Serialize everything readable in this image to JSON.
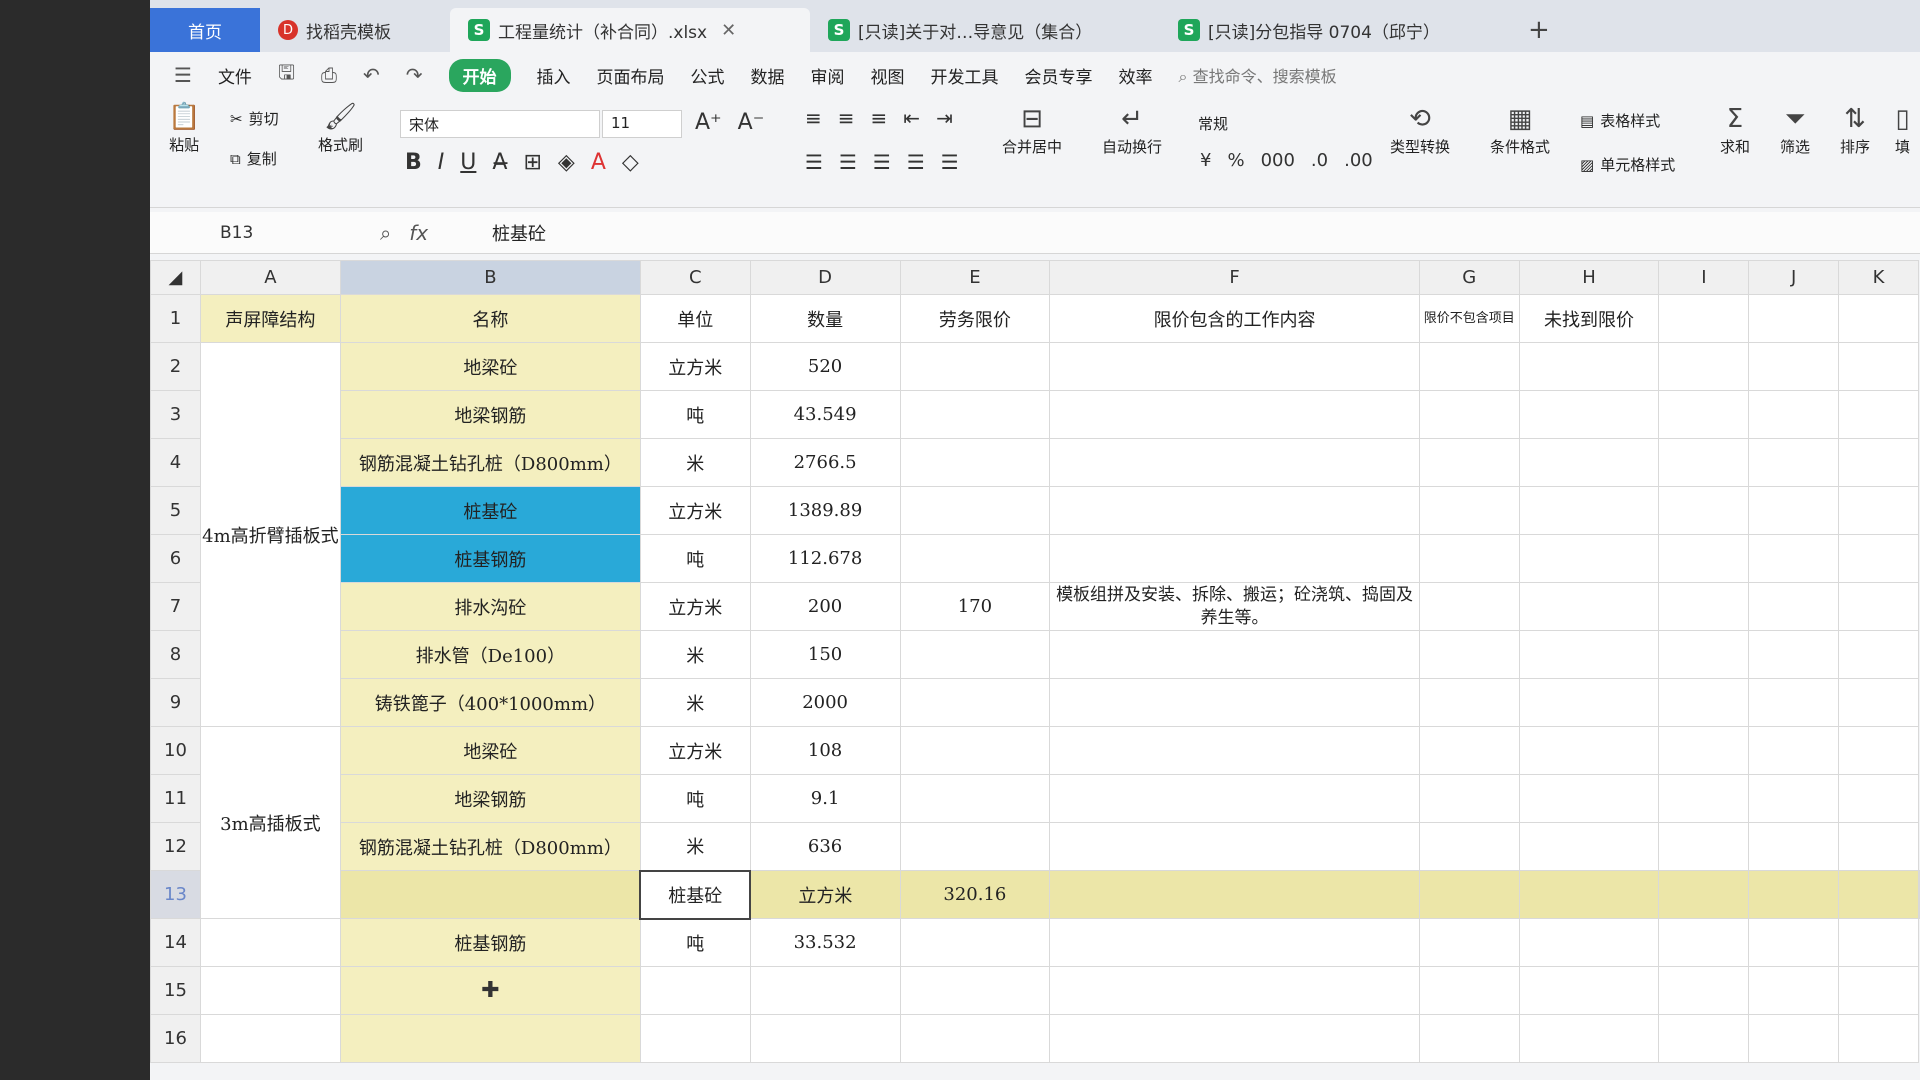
{
  "tabs": [
    {
      "label": "首页"
    },
    {
      "label": "找稻壳模板"
    },
    {
      "label": "工程量统计（补合同）.xlsx"
    },
    {
      "label": "[只读]关于对…导意见（集合）"
    },
    {
      "label": "[只读]分包指导 0704（邱宁）"
    }
  ],
  "menu": {
    "file": "文件",
    "items": [
      "开始",
      "插入",
      "页面布局",
      "公式",
      "数据",
      "审阅",
      "视图",
      "开发工具",
      "会员专享",
      "效率"
    ],
    "search": "查找命令、搜索模板"
  },
  "ribbon": {
    "paste": "粘贴",
    "cut": "剪切",
    "copy": "复制",
    "format_painter": "格式刷",
    "font": "宋体",
    "size": "11",
    "merge": "合并居中",
    "wrap": "自动换行",
    "number_format": "常规",
    "type_convert": "类型转换",
    "cond_format": "条件格式",
    "table_style": "表格样式",
    "cell_style": "单元格样式",
    "sum": "求和",
    "filter": "筛选",
    "sort": "排序",
    "fill": "填"
  },
  "formula_bar": {
    "cell": "B13",
    "value": "桩基砼"
  },
  "columns": [
    "A",
    "B",
    "C",
    "D",
    "E",
    "F",
    "G",
    "H",
    "I",
    "J",
    "K"
  ],
  "header_row": {
    "a": "声屏障结构",
    "b": "名称",
    "c": "单位",
    "d": "数量",
    "e": "劳务限价",
    "f": "限价包含的工作内容",
    "g": "限价不包含项目",
    "h": "未找到限价"
  },
  "groups": {
    "g1": "4m高折臂插板式",
    "g2": "3m高插板式"
  },
  "rows": [
    {
      "n": "2",
      "name": "地梁砼",
      "unit": "立方米",
      "qty": "520"
    },
    {
      "n": "3",
      "name": "地梁钢筋",
      "unit": "吨",
      "qty": "43.549"
    },
    {
      "n": "4",
      "name": "钢筋混凝土钻孔桩（D800mm）",
      "unit": "米",
      "qty": "2766.5"
    },
    {
      "n": "5",
      "name": "桩基砼",
      "unit": "立方米",
      "qty": "1389.89"
    },
    {
      "n": "6",
      "name": "桩基钢筋",
      "unit": "吨",
      "qty": "112.678"
    },
    {
      "n": "7",
      "name": "排水沟砼",
      "unit": "立方米",
      "qty": "200",
      "price": "170",
      "content": "模板组拼及安装、拆除、搬运；砼浇筑、捣固及养生等。"
    },
    {
      "n": "8",
      "name": "排水管（De100）",
      "unit": "米",
      "qty": "150"
    },
    {
      "n": "9",
      "name": "铸铁篦子（400*1000mm）",
      "unit": "米",
      "qty": "2000"
    },
    {
      "n": "10",
      "name": "地梁砼",
      "unit": "立方米",
      "qty": "108"
    },
    {
      "n": "11",
      "name": "地梁钢筋",
      "unit": "吨",
      "qty": "9.1"
    },
    {
      "n": "12",
      "name": "钢筋混凝土钻孔桩（D800mm）",
      "unit": "米",
      "qty": "636"
    },
    {
      "n": "13",
      "name": "桩基砼",
      "unit": "立方米",
      "qty": "320.16"
    },
    {
      "n": "14",
      "name": "桩基钢筋",
      "unit": "吨",
      "qty": "33.532"
    },
    {
      "n": "15"
    },
    {
      "n": "16"
    }
  ],
  "colors": {
    "accent_green": "#2aa65e",
    "header_yellow": "#f4efbf",
    "highlight_blue": "#29a9d8",
    "home_tab": "#3a73d9"
  }
}
